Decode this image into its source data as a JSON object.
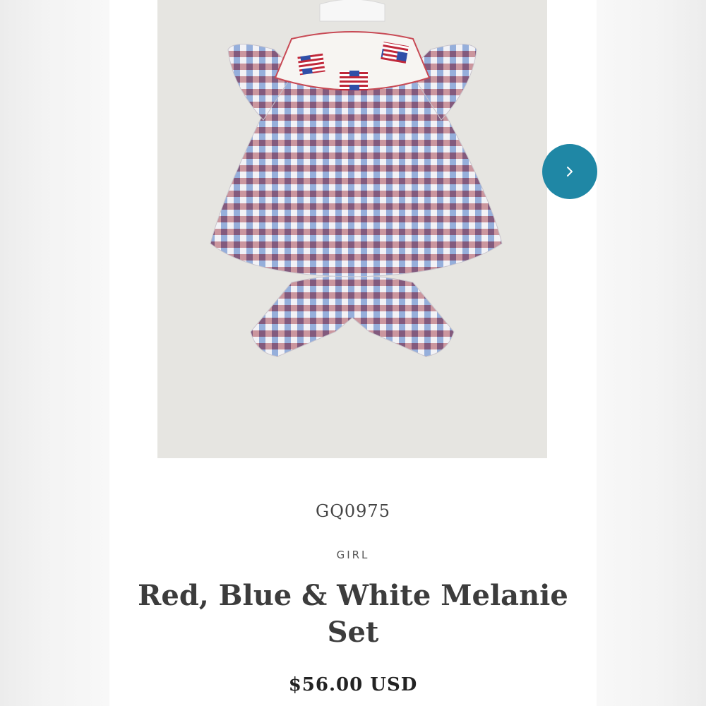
{
  "product": {
    "sku": "GQ0975",
    "category": "GIRL",
    "title": "Red, Blue & White Melanie Set",
    "price": "$56.00 USD",
    "image_description_icon": "product-photo"
  },
  "gallery": {
    "next_icon": "chevron-right-icon"
  },
  "colors": {
    "accent": "#1f87a5",
    "check_red": "#9b2634",
    "check_blue": "#4a78c4",
    "background_photo": "#e6e5e1"
  }
}
